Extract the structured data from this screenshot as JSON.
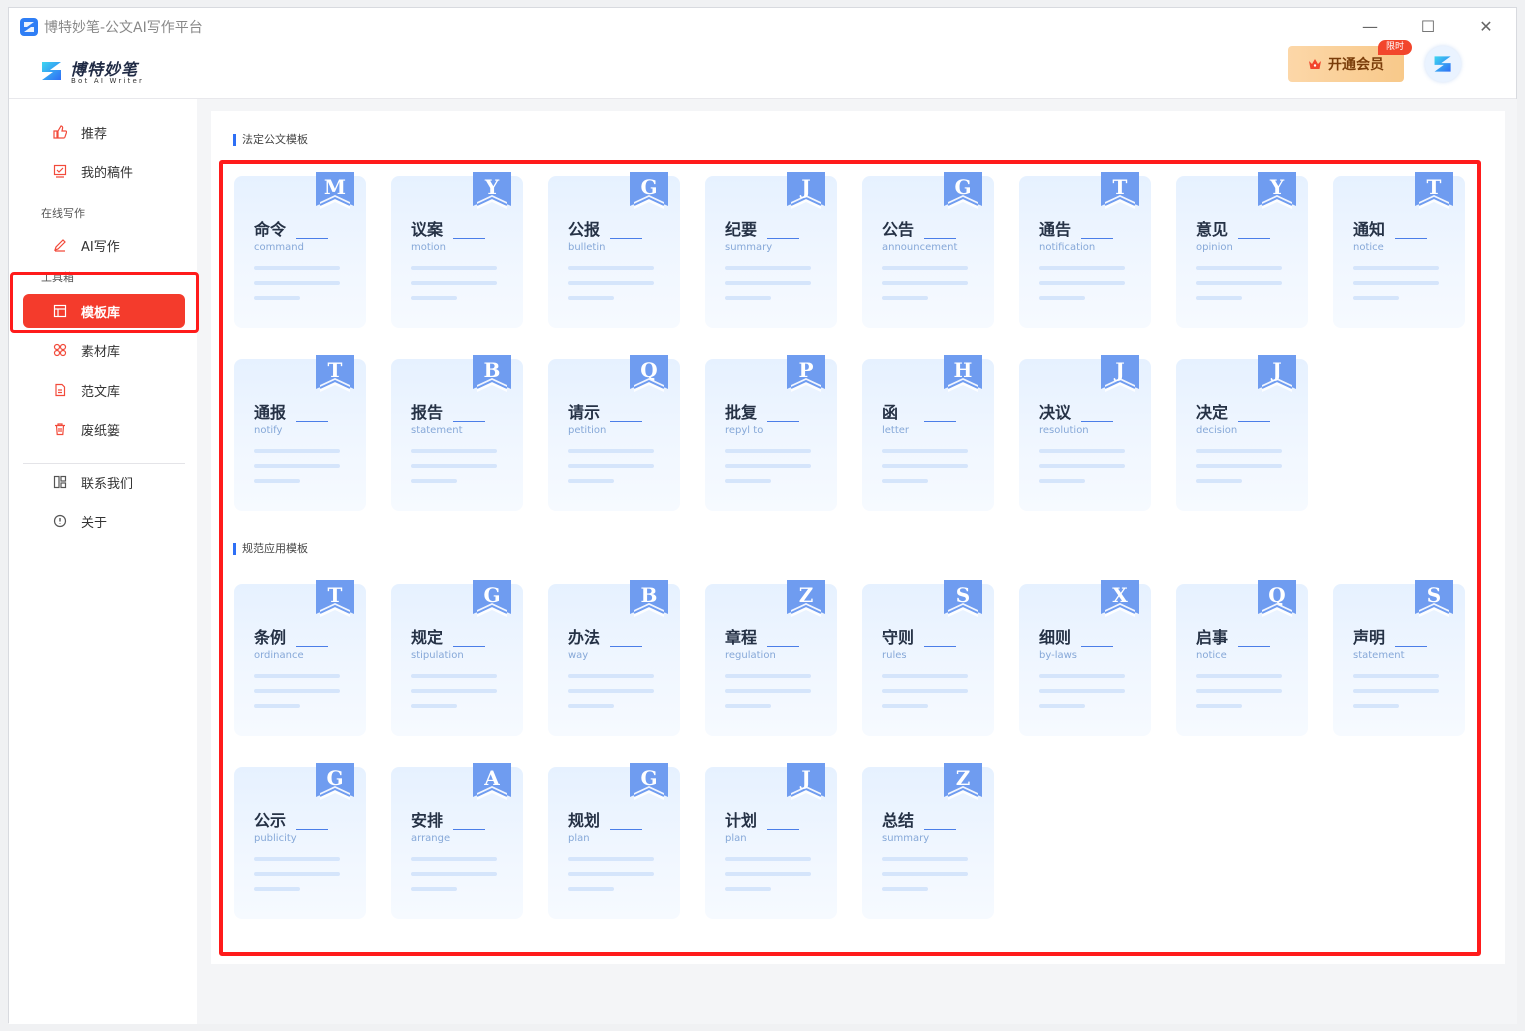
{
  "window": {
    "title": "博特妙笔-公文AI写作平台",
    "controls": {
      "minimize": "—",
      "maximize": "☐",
      "close": "✕"
    }
  },
  "header": {
    "logo_cn": "博特妙笔",
    "logo_en": "Bot AI Writer",
    "vip_label": "开通会员",
    "vip_badge": "限时"
  },
  "sidebar": {
    "recommend": "推荐",
    "my_drafts": "我的稿件",
    "group_online": "在线写作",
    "ai_write": "AI写作",
    "group_tools": "工具箱",
    "template_lib": "模板库",
    "material_lib": "素材库",
    "sample_lib": "范文库",
    "trash": "废纸篓",
    "contact": "联系我们",
    "about": "关于"
  },
  "colors": {
    "accent_red": "#f43b2c",
    "accent_blue": "#2e6ff5",
    "flag_blue": "#6f9cf0"
  },
  "sections": [
    {
      "title": "法定公文模板",
      "cards": [
        {
          "cn": "命令",
          "en": "command",
          "letter": "M"
        },
        {
          "cn": "议案",
          "en": "motion",
          "letter": "Y"
        },
        {
          "cn": "公报",
          "en": "bulletin",
          "letter": "G"
        },
        {
          "cn": "纪要",
          "en": "summary",
          "letter": "J"
        },
        {
          "cn": "公告",
          "en": "announcement",
          "letter": "G"
        },
        {
          "cn": "通告",
          "en": "notification",
          "letter": "T"
        },
        {
          "cn": "意见",
          "en": "opinion",
          "letter": "Y"
        },
        {
          "cn": "通知",
          "en": "notice",
          "letter": "T"
        },
        {
          "cn": "通报",
          "en": "notify",
          "letter": "T"
        },
        {
          "cn": "报告",
          "en": "statement",
          "letter": "B"
        },
        {
          "cn": "请示",
          "en": "petition",
          "letter": "Q"
        },
        {
          "cn": "批复",
          "en": "repyl to",
          "letter": "P"
        },
        {
          "cn": "函",
          "en": "letter",
          "letter": "H"
        },
        {
          "cn": "决议",
          "en": "resolution",
          "letter": "J"
        },
        {
          "cn": "决定",
          "en": "decision",
          "letter": "J"
        }
      ]
    },
    {
      "title": "规范应用模板",
      "cards": [
        {
          "cn": "条例",
          "en": "ordinance",
          "letter": "T"
        },
        {
          "cn": "规定",
          "en": "stipulation",
          "letter": "G"
        },
        {
          "cn": "办法",
          "en": "way",
          "letter": "B"
        },
        {
          "cn": "章程",
          "en": "regulation",
          "letter": "Z"
        },
        {
          "cn": "守则",
          "en": "rules",
          "letter": "S"
        },
        {
          "cn": "细则",
          "en": "by-laws",
          "letter": "X"
        },
        {
          "cn": "启事",
          "en": "notice",
          "letter": "Q"
        },
        {
          "cn": "声明",
          "en": "statement",
          "letter": "S"
        },
        {
          "cn": "公示",
          "en": "publicity",
          "letter": "G"
        },
        {
          "cn": "安排",
          "en": "arrange",
          "letter": "A"
        },
        {
          "cn": "规划",
          "en": "plan",
          "letter": "G"
        },
        {
          "cn": "计划",
          "en": "plan",
          "letter": "J"
        },
        {
          "cn": "总结",
          "en": "summary",
          "letter": "Z"
        }
      ]
    }
  ]
}
